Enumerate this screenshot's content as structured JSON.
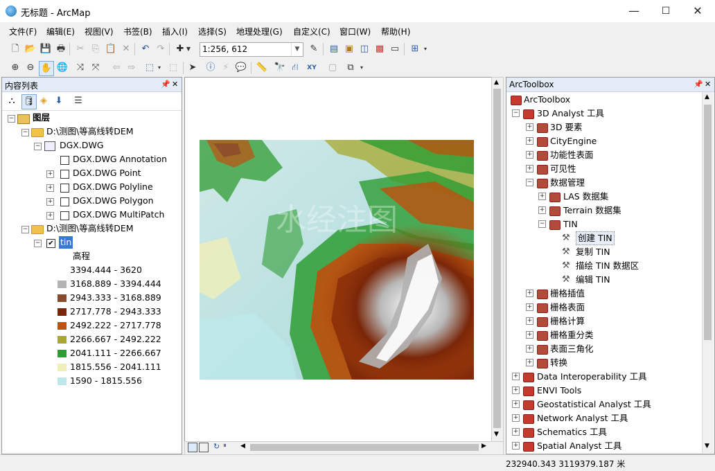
{
  "window": {
    "title": "无标题 - ArcMap",
    "min": "—",
    "max": "☐",
    "close": "✕"
  },
  "menu": [
    "文件(F)",
    "编辑(E)",
    "视图(V)",
    "书签(B)",
    "插入(I)",
    "选择(S)",
    "地理处理(G)",
    "自定义(C)",
    "窗口(W)",
    "帮助(H)"
  ],
  "toolbar": {
    "scale": "1:256, 612"
  },
  "toc": {
    "title": "内容列表",
    "root": "图层",
    "group1": "D:\\测图\\等高线转DEM",
    "dataset": "DGX.DWG",
    "sublayers": [
      "DGX.DWG Annotation",
      "DGX.DWG Point",
      "DGX.DWG Polyline",
      "DGX.DWG Polygon",
      "DGX.DWG MultiPatch"
    ],
    "group2": "D:\\测图\\等高线转DEM",
    "tin_layer": "tin",
    "elev_label": "高程",
    "legend": [
      {
        "label": "3394.444 - 3620",
        "color": "#ffffff"
      },
      {
        "label": "3168.889 - 3394.444",
        "color": "#b3b3b3"
      },
      {
        "label": "2943.333 - 3168.889",
        "color": "#8a4a2c"
      },
      {
        "label": "2717.778 - 2943.333",
        "color": "#7a2608"
      },
      {
        "label": "2492.222 - 2717.778",
        "color": "#c0500e"
      },
      {
        "label": "2266.667 - 2492.222",
        "color": "#a7a82c"
      },
      {
        "label": "2041.111 - 2266.667",
        "color": "#2d9c32"
      },
      {
        "label": "1815.556 - 2041.111",
        "color": "#efefb7"
      },
      {
        "label": "1590 - 1815.556",
        "color": "#bde8ea"
      }
    ]
  },
  "map": {
    "watermark": "水经注图 SHUIJINGZHU / WMAP GIS"
  },
  "arctoolbox": {
    "title": "ArcToolbox",
    "root": "ArcToolbox",
    "analyst3d": "3D Analyst 工具",
    "items3d": [
      "3D 要素",
      "CityEngine",
      "功能性表面",
      "可见性"
    ],
    "data_mgmt": "数据管理",
    "las": "LAS 数据集",
    "terrain": "Terrain 数据集",
    "tin": "TIN",
    "tin_tools": [
      "创建 TIN",
      "复制 TIN",
      "描绘 TIN 数据区",
      "编辑 TIN"
    ],
    "items3d_after": [
      "栅格插值",
      "栅格表面",
      "栅格计算",
      "栅格重分类",
      "表面三角化",
      "转换"
    ],
    "toolboxes": [
      "Data Interoperability 工具",
      "ENVI Tools",
      "Geostatistical Analyst 工具",
      "Network Analyst 工具",
      "Schematics 工具",
      "Spatial Analyst 工具"
    ]
  },
  "status": {
    "coords": "232940.343  3119379.187 米"
  }
}
